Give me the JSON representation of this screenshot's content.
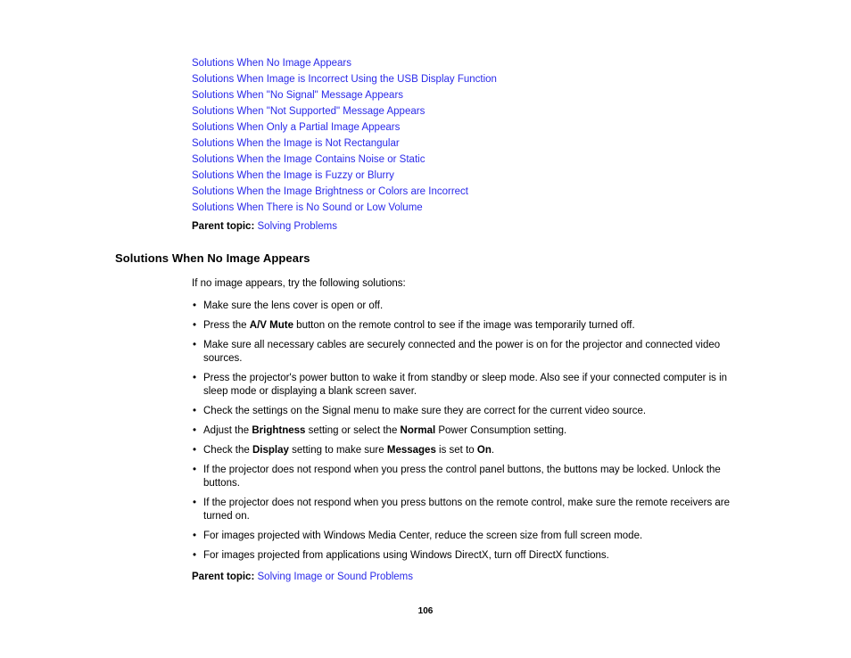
{
  "document": {
    "page_number": "106"
  },
  "toc": {
    "links": [
      "Solutions When No Image Appears",
      "Solutions When Image is Incorrect Using the USB Display Function",
      "Solutions When \"No Signal\" Message Appears",
      "Solutions When \"Not Supported\" Message Appears",
      "Solutions When Only a Partial Image Appears",
      "Solutions When the Image is Not Rectangular",
      "Solutions When the Image Contains Noise or Static",
      "Solutions When the Image is Fuzzy or Blurry",
      "Solutions When the Image Brightness or Colors are Incorrect",
      "Solutions When There is No Sound or Low Volume"
    ],
    "parent_topic": {
      "label": "Parent topic:",
      "link": "Solving Problems"
    }
  },
  "section": {
    "heading": "Solutions When No Image Appears",
    "intro": "If no image appears, try the following solutions:",
    "bullet_marker": "•",
    "bullets": [
      [
        {
          "text": "Make sure the lens cover is open or off.",
          "bold": false
        }
      ],
      [
        {
          "text": "Press the ",
          "bold": false
        },
        {
          "text": "A/V Mute",
          "bold": true
        },
        {
          "text": " button on the remote control to see if the image was temporarily turned off.",
          "bold": false
        }
      ],
      [
        {
          "text": "Make sure all necessary cables are securely connected and the power is on for the projector and connected video sources.",
          "bold": false
        }
      ],
      [
        {
          "text": "Press the projector's power button to wake it from standby or sleep mode. Also see if your connected computer is in sleep mode or displaying a blank screen saver.",
          "bold": false
        }
      ],
      [
        {
          "text": "Check the settings on the Signal menu to make sure they are correct for the current video source.",
          "bold": false
        }
      ],
      [
        {
          "text": "Adjust the ",
          "bold": false
        },
        {
          "text": "Brightness",
          "bold": true
        },
        {
          "text": " setting or select the ",
          "bold": false
        },
        {
          "text": "Normal",
          "bold": true
        },
        {
          "text": " Power Consumption setting.",
          "bold": false
        }
      ],
      [
        {
          "text": "Check the ",
          "bold": false
        },
        {
          "text": "Display",
          "bold": true
        },
        {
          "text": " setting to make sure ",
          "bold": false
        },
        {
          "text": "Messages",
          "bold": true
        },
        {
          "text": " is set to ",
          "bold": false
        },
        {
          "text": "On",
          "bold": true
        },
        {
          "text": ".",
          "bold": false
        }
      ],
      [
        {
          "text": "If the projector does not respond when you press the control panel buttons, the buttons may be locked. Unlock the buttons.",
          "bold": false
        }
      ],
      [
        {
          "text": "If the projector does not respond when you press buttons on the remote control, make sure the remote receivers are turned on.",
          "bold": false
        }
      ],
      [
        {
          "text": "For images projected with Windows Media Center, reduce the screen size from full screen mode.",
          "bold": false
        }
      ],
      [
        {
          "text": "For images projected from applications using Windows DirectX, turn off DirectX functions.",
          "bold": false
        }
      ]
    ],
    "parent_topic": {
      "label": "Parent topic:",
      "link": "Solving Image or Sound Problems"
    }
  },
  "colors": {
    "link": "#2a2aea",
    "text": "#000000",
    "background": "#ffffff"
  }
}
